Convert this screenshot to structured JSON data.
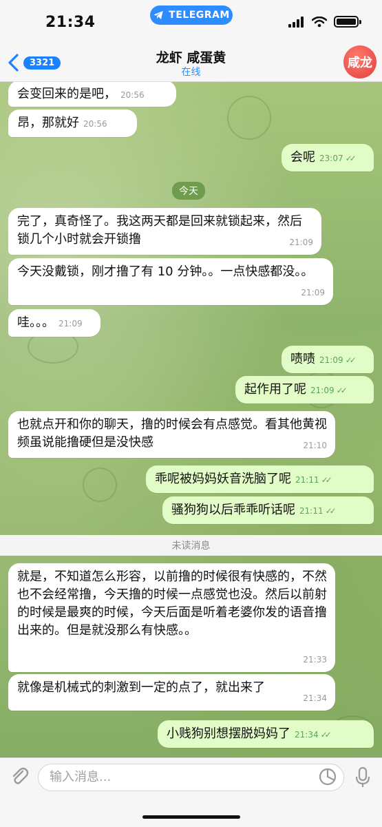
{
  "status_bar": {
    "time": "21:34",
    "app_pill": "TELEGRAM"
  },
  "header": {
    "back_count": "3321",
    "title": "龙虾 咸蛋黄",
    "subtitle": "在线",
    "avatar_text": "咸龙"
  },
  "labels": {
    "today": "今天",
    "unread": "未读消息"
  },
  "messages": [
    {
      "dir": "in",
      "text": "会变回来的是吧，",
      "time": "20:56"
    },
    {
      "dir": "in",
      "text": "昂，那就好",
      "time": "20:56"
    },
    {
      "dir": "out",
      "text": "会呢",
      "time": "23:07"
    },
    {
      "dir": "in",
      "text": "完了，真奇怪了。我这两天都是回来就锁起来，然后锁几个小时就会开锁撸",
      "time": "21:09"
    },
    {
      "dir": "in",
      "text": "今天没戴锁，刚才撸了有 10 分钟。。一点快感都没。。",
      "time": "21:09"
    },
    {
      "dir": "in",
      "text": "哇。。。",
      "time": "21:09"
    },
    {
      "dir": "out",
      "text": "啧啧",
      "time": "21:09"
    },
    {
      "dir": "out",
      "text": "起作用了呢",
      "time": "21:09"
    },
    {
      "dir": "in",
      "text": "也就点开和你的聊天，撸的时候会有点感觉。看其他黄视频虽说能撸硬但是没快感",
      "time": "21:10"
    },
    {
      "dir": "out",
      "text": "乖呢被妈妈妖音洗脑了呢",
      "time": "21:11"
    },
    {
      "dir": "out",
      "text": "骚狗狗以后乖乖听话呢",
      "time": "21:11"
    },
    {
      "dir": "in",
      "text": "就是，不知道怎么形容，以前撸的时候很有快感的，不然也不会经常撸，今天撸的时候一点感觉也没。然后以前射的时候是最爽的时候，今天后面是听着老婆你发的语音撸出来的。但是就没那么有快感。。",
      "time": "21:33"
    },
    {
      "dir": "in",
      "text": "就像是机械式的刺激到一定的点了，就出来了",
      "time": "21:34"
    },
    {
      "dir": "out",
      "text": "小贱狗别想摆脱妈妈了",
      "time": "21:34"
    }
  ],
  "composer": {
    "placeholder": "输入消息..."
  },
  "colors": {
    "accent": "#2f8cff",
    "outgoing": "#e2fcc8",
    "incoming": "#ffffff"
  }
}
